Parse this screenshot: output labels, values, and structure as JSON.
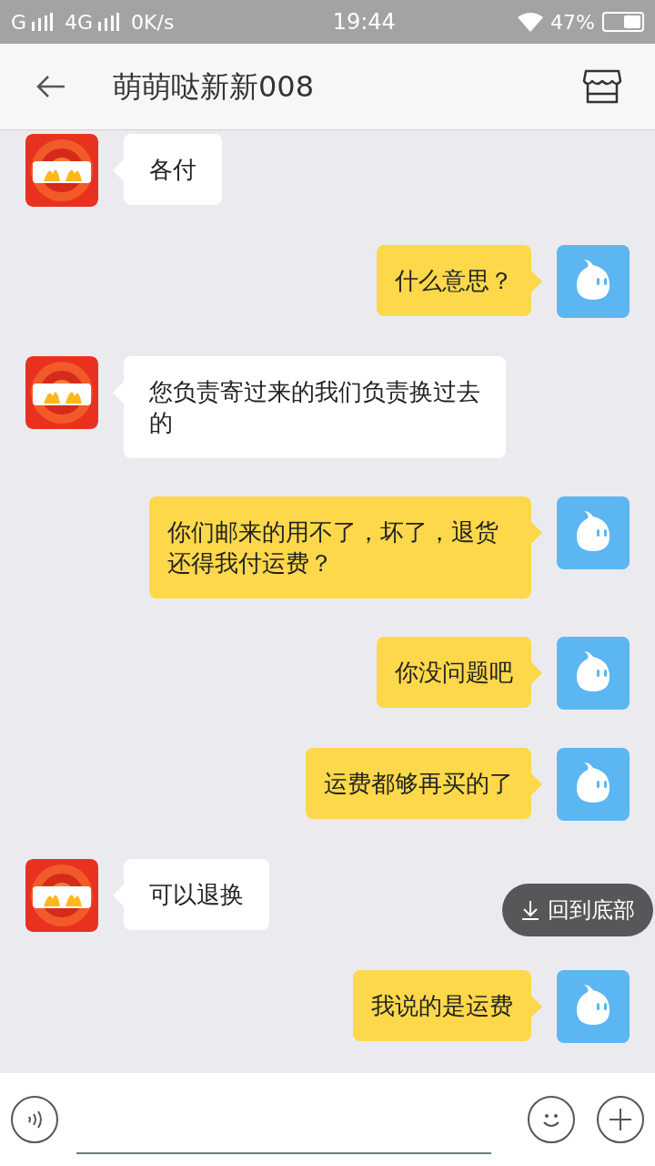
{
  "status_bar": {
    "network_1": "G",
    "network_2": "4G",
    "speed": "0K/s",
    "time": "19:44",
    "battery": "47%"
  },
  "header": {
    "title": "萌萌哒新新008"
  },
  "messages": [
    {
      "kind": "incoming",
      "text": "各付"
    },
    {
      "kind": "outgoing",
      "text": "什么意思？"
    },
    {
      "kind": "incoming",
      "text": "您负责寄过来的我们负责换过去的"
    },
    {
      "kind": "outgoing",
      "text": "你们邮来的用不了，坏了，退货还得我付运费？"
    },
    {
      "kind": "outgoing",
      "text": "你没问题吧"
    },
    {
      "kind": "outgoing",
      "text": "运费都够再买的了"
    },
    {
      "kind": "incoming",
      "text": "可以退换"
    },
    {
      "kind": "outgoing",
      "text": "我说的是运费"
    }
  ],
  "jump_button": {
    "label": "回到底部"
  }
}
